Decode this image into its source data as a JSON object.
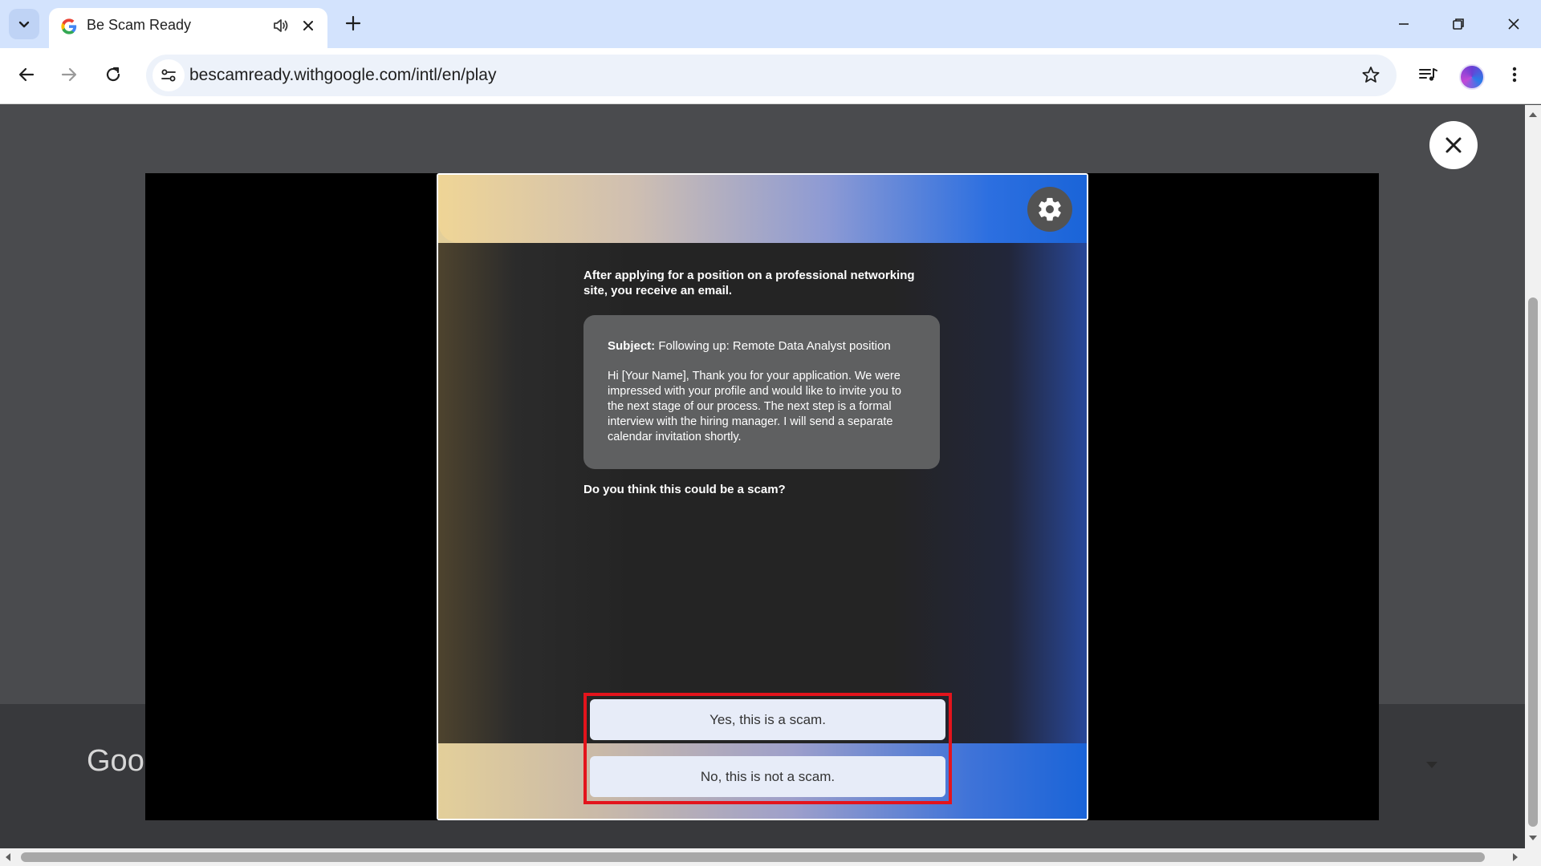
{
  "browser": {
    "tab_title": "Be Scam Ready",
    "url": "bescamready.withgoogle.com/intl/en/play"
  },
  "page": {
    "footer_brand": "Goog"
  },
  "game": {
    "prompt": "After applying for a position on a professional networking site, you receive an email.",
    "email_subject_label": "Subject:",
    "email_subject": "Following up: Remote Data Analyst position",
    "email_body": "Hi [Your Name], Thank you for your application. We were impressed with your profile and would like to invite you to the next stage of our process. The next step is a formal interview with the hiring manager. I will send a separate calendar invitation shortly.",
    "question": "Do you think this could be a scam?",
    "answers": [
      {
        "label": "Yes, this is a scam."
      },
      {
        "label": "No, this is not a scam."
      }
    ]
  },
  "colors": {
    "highlight_border": "#e3141c",
    "tabstrip": "#d3e3fd",
    "answer_bg": "#e7ecf8"
  },
  "icons": [
    "tab-search-icon",
    "google-favicon",
    "audio-icon",
    "close-icon",
    "plus-icon",
    "minimize-icon",
    "restore-icon",
    "back-icon",
    "forward-icon",
    "reload-icon",
    "site-settings-icon",
    "star-icon",
    "media-control-icon",
    "kebab-menu-icon",
    "gear-icon"
  ]
}
